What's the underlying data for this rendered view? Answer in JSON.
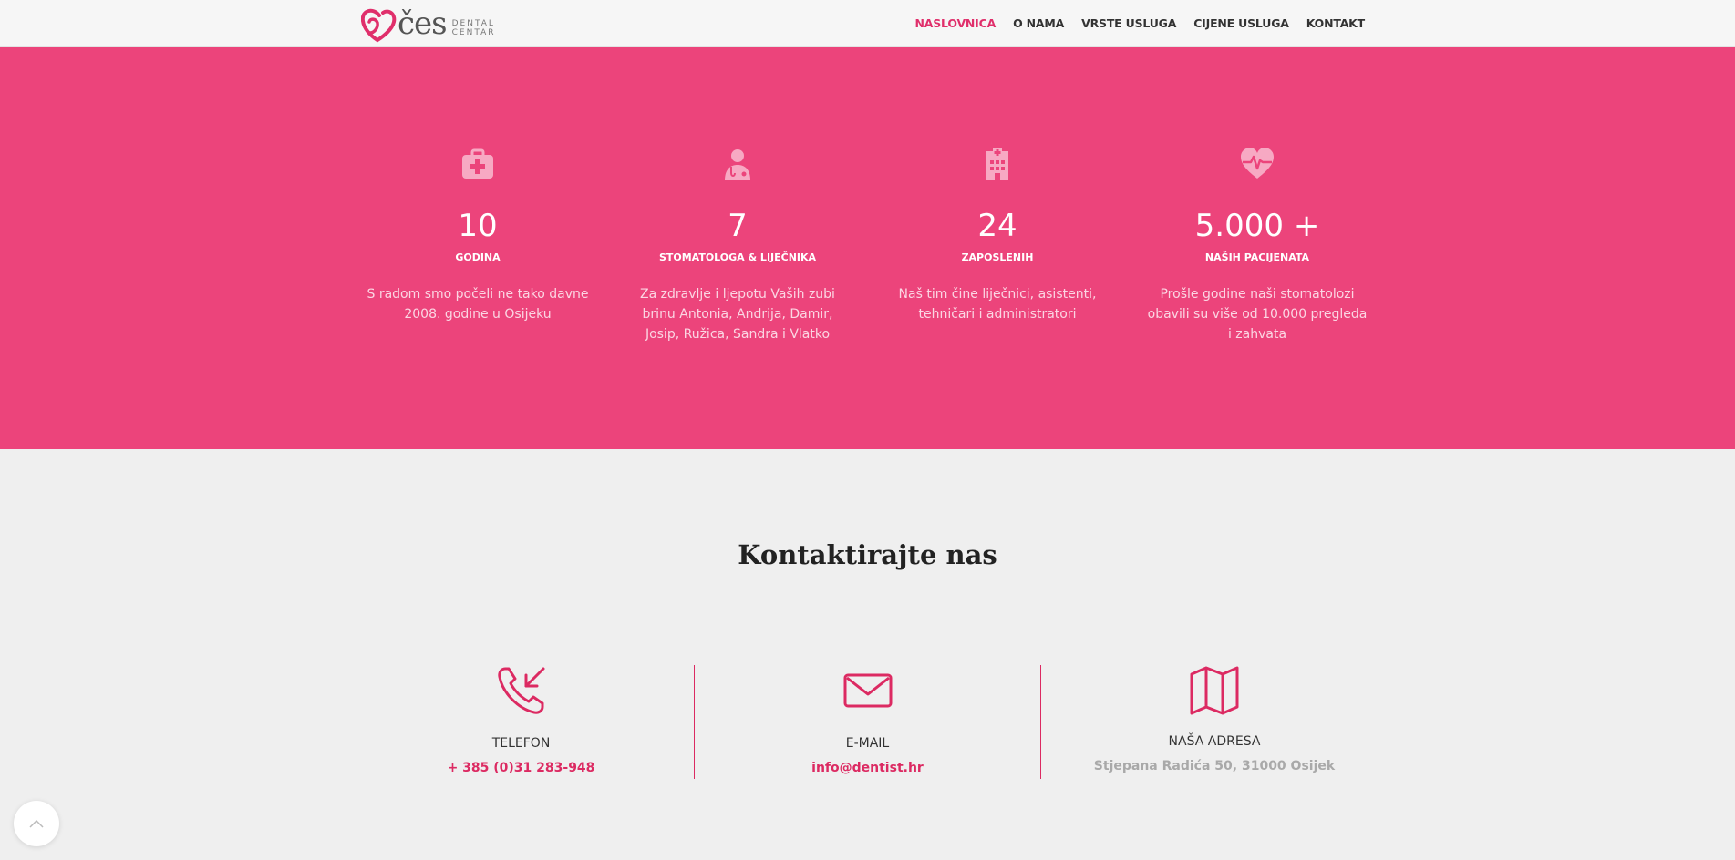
{
  "header": {
    "logo": {
      "name": "čes",
      "sub_line1": "DENTAL",
      "sub_line2": "CENTAR"
    },
    "nav": [
      {
        "label": "NASLOVNICA",
        "active": true
      },
      {
        "label": "O NAMA",
        "active": false
      },
      {
        "label": "VRSTE USLUGA",
        "active": false
      },
      {
        "label": "CIJENE USLUGA",
        "active": false
      },
      {
        "label": "KONTAKT",
        "active": false
      }
    ]
  },
  "stats": [
    {
      "icon": "medical-kit-icon",
      "number": "10",
      "label": "GODINA",
      "desc": "S radom smo počeli ne tako davne 2008. godine u Osijeku"
    },
    {
      "icon": "doctor-icon",
      "number": "7",
      "label": "STOMATOLOGA & LIJEČNIKA",
      "desc": "Za zdravlje i ljepotu Vaših zubi brinu Antonia, Andrija, Damir, Josip, Ružica, Sandra i Vlatko"
    },
    {
      "icon": "hospital-icon",
      "number": "24",
      "label": "ZAPOSLENIH",
      "desc": "Naš tim čine liječnici, asistenti, tehničari i administratori"
    },
    {
      "icon": "heartbeat-icon",
      "number": "5.000 +",
      "label": "NAŠIH PACIJENATA",
      "desc": "Prošle godine naši stomatolozi obavili su više od 10.000 pregleda i zahvata"
    }
  ],
  "contact": {
    "title": "Kontaktirajte nas",
    "items": [
      {
        "icon": "phone-incoming-icon",
        "label": "TELEFON",
        "value": "+ 385 (0)31 283-948"
      },
      {
        "icon": "envelope-icon",
        "label": "E-MAIL",
        "value": "info@dentist.hr"
      },
      {
        "icon": "map-icon",
        "label": "NAŠA ADRESA",
        "value": "Stjepana Radića 50, 31000 Osijek"
      }
    ]
  },
  "colors": {
    "accent": "#e02f6b",
    "band": "#ec447b",
    "background": "#efefef"
  }
}
